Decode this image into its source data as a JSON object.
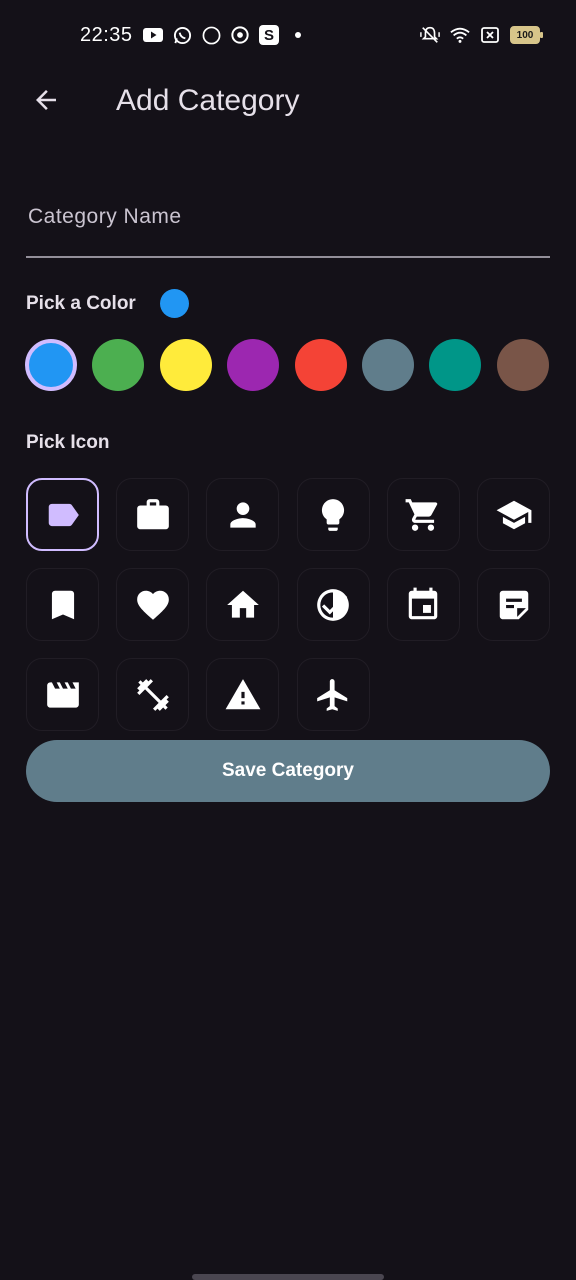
{
  "status_bar": {
    "time": "22:35",
    "battery": "100",
    "left_icons": [
      "youtube-icon",
      "whatsapp-icon",
      "sb-icon",
      "chrome-icon",
      "s-app-icon",
      "dot-icon"
    ],
    "right_icons": [
      "mute-vibrate-icon",
      "wifi-icon",
      "box-x-icon",
      "battery-icon"
    ],
    "sb_badge": "sb.",
    "s_badge": "S"
  },
  "app_bar": {
    "title": "Add Category",
    "back_icon": "arrow-back-icon"
  },
  "name_field": {
    "placeholder": "Category Name",
    "value": ""
  },
  "color_section": {
    "label": "Pick a Color",
    "selected_color": "#2196f3",
    "colors": [
      {
        "name": "blue",
        "hex": "#2196f3",
        "selected": true
      },
      {
        "name": "green",
        "hex": "#4caf50",
        "selected": false
      },
      {
        "name": "yellow",
        "hex": "#ffeb3b",
        "selected": false
      },
      {
        "name": "purple",
        "hex": "#9c27b0",
        "selected": false
      },
      {
        "name": "red",
        "hex": "#f44336",
        "selected": false
      },
      {
        "name": "blue-grey",
        "hex": "#607d8b",
        "selected": false
      },
      {
        "name": "teal",
        "hex": "#009688",
        "selected": false
      },
      {
        "name": "brown",
        "hex": "#795548",
        "selected": false
      }
    ]
  },
  "icon_section": {
    "label": "Pick Icon",
    "icons": [
      {
        "name": "label-icon",
        "selected": true
      },
      {
        "name": "work-icon",
        "selected": false
      },
      {
        "name": "person-icon",
        "selected": false
      },
      {
        "name": "lightbulb-icon",
        "selected": false
      },
      {
        "name": "shopping-cart-icon",
        "selected": false
      },
      {
        "name": "school-icon",
        "selected": false
      },
      {
        "name": "bookmark-icon",
        "selected": false
      },
      {
        "name": "favorite-icon",
        "selected": false
      },
      {
        "name": "home-icon",
        "selected": false
      },
      {
        "name": "check-circle-icon",
        "selected": false
      },
      {
        "name": "event-icon",
        "selected": false
      },
      {
        "name": "sticky-note-icon",
        "selected": false
      },
      {
        "name": "movie-icon",
        "selected": false
      },
      {
        "name": "fitness-icon",
        "selected": false
      },
      {
        "name": "warning-icon",
        "selected": false
      },
      {
        "name": "flight-icon",
        "selected": false
      }
    ]
  },
  "accent_color": "#d0bcff",
  "save_button": {
    "label": "Save Category",
    "color": "#607d8b"
  }
}
